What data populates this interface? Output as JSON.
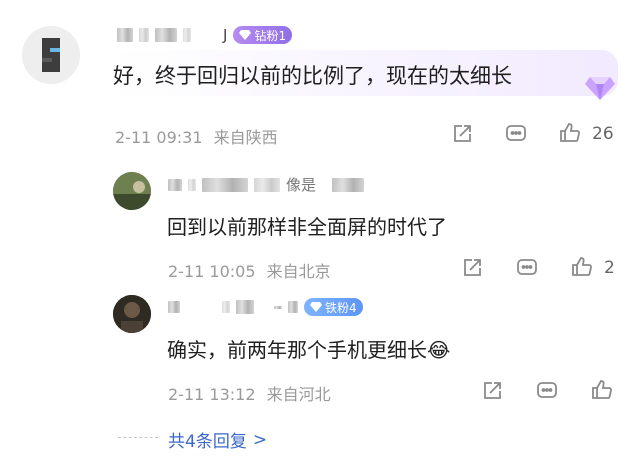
{
  "top_comment": {
    "username_tail": "J",
    "badge": "钻粉1",
    "text": "好，终于回归以前的比例了，现在的太细长",
    "time": "2-11 09:31",
    "location": "来自陕西",
    "likes": "26"
  },
  "reply1": {
    "username_visible": "像是",
    "text": "回到以前那样非全面屏的时代了",
    "time": "2-11 10:05",
    "location": "来自北京",
    "likes": "2"
  },
  "reply2": {
    "badge": "铁粉4",
    "text": "确实，前两年那个手机更细长",
    "emoji": "😂",
    "time": "2-11 13:12",
    "location": "来自河北"
  },
  "more_replies": {
    "label": "共4条回复",
    "arrow": ">"
  },
  "icons": {
    "share": "share-icon",
    "comment": "comment-icon",
    "like": "thumbs-up-icon",
    "badge_diamond": "diamond-icon"
  },
  "colors": {
    "accent_link": "#3b69c7",
    "badge_purple": "#9b79ee",
    "badge_blue": "#5c95f5",
    "meta_gray": "#9a9a9a"
  }
}
